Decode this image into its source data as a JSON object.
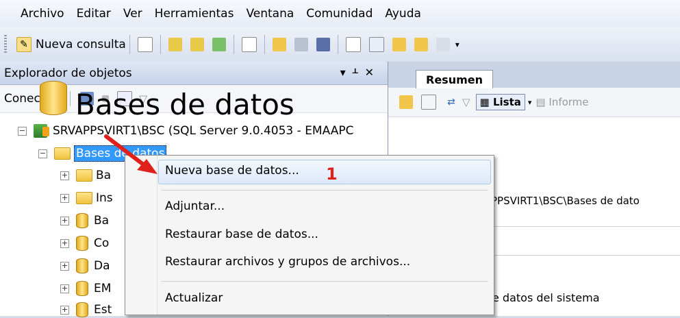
{
  "menubar": {
    "items": [
      "Archivo",
      "Editar",
      "Ver",
      "Herramientas",
      "Ventana",
      "Comunidad",
      "Ayuda"
    ]
  },
  "toolbar": {
    "new_query_label": "Nueva consulta",
    "icons": [
      "new-project-icon",
      "db-query-icon",
      "mdx-query-icon",
      "dmx-query-icon",
      "xmla-query-icon",
      "new-file-icon",
      "open-folder-icon",
      "save-icon",
      "save-all-icon",
      "properties-icon",
      "registered-servers-icon",
      "object-explorer-icon",
      "template-explorer-icon",
      "solution-explorer-icon",
      "overflow-icon"
    ]
  },
  "object_explorer": {
    "title": "Explorador de objetos",
    "connect_label": "Conectar",
    "tree": {
      "server": "SRVAPPSVIRT1\\BSC (SQL Server 9.0.4053 - EMAAPC",
      "databases_node": "Bases de datos",
      "children": [
        "Ba",
        "Ins",
        "Ba",
        "Co",
        "Da",
        "EM",
        "Est"
      ]
    }
  },
  "summary": {
    "tab_label": "Resumen",
    "list_label": "Lista",
    "report_label": "Informe",
    "big_title": "Bases de datos",
    "path": "PPSVIRT1\\BSC\\Bases de dato",
    "line1": "e datos del sistema"
  },
  "context_menu": {
    "items": [
      "Nueva base de datos...",
      "Adjuntar...",
      "Restaurar base de datos...",
      "Restaurar archivos y grupos de archivos...",
      "Actualizar"
    ],
    "step_label": "1"
  },
  "colors": {
    "selection": "#3399ff",
    "arrow": "#e0201b",
    "highlight_border": "#a8c8eb"
  }
}
